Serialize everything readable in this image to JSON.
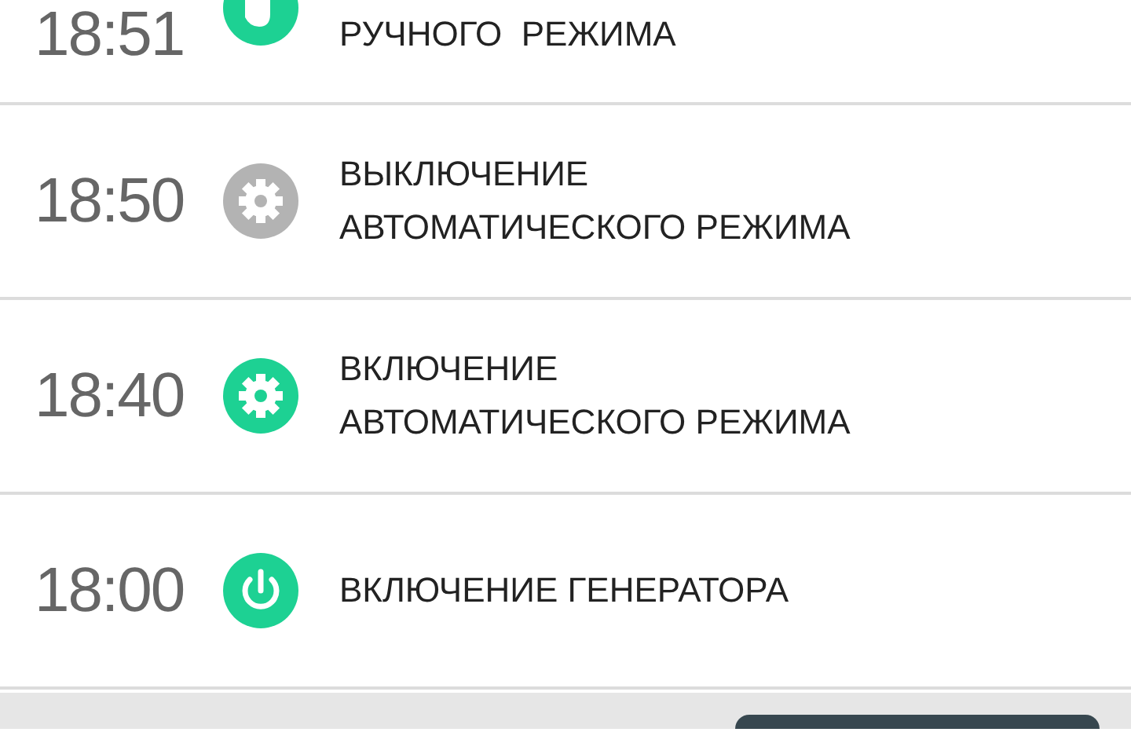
{
  "events": [
    {
      "time": "18:51",
      "lines": [
        "РУЧНОГО  РЕЖИМА"
      ],
      "kind": "hand",
      "active": true
    },
    {
      "time": "18:50",
      "lines": [
        "ВЫКЛЮЧЕНИЕ",
        "АВТОМАТИЧЕСКОГО РЕЖИМА"
      ],
      "kind": "gear",
      "active": false
    },
    {
      "time": "18:40",
      "lines": [
        "ВКЛЮЧЕНИЕ",
        "АВТОМАТИЧЕСКОГО РЕЖИМА"
      ],
      "kind": "gear",
      "active": true
    },
    {
      "time": "18:00",
      "lines": [
        "ВКЛЮЧЕНИЕ ГЕНЕРАТОРА"
      ],
      "kind": "power",
      "active": true
    }
  ]
}
